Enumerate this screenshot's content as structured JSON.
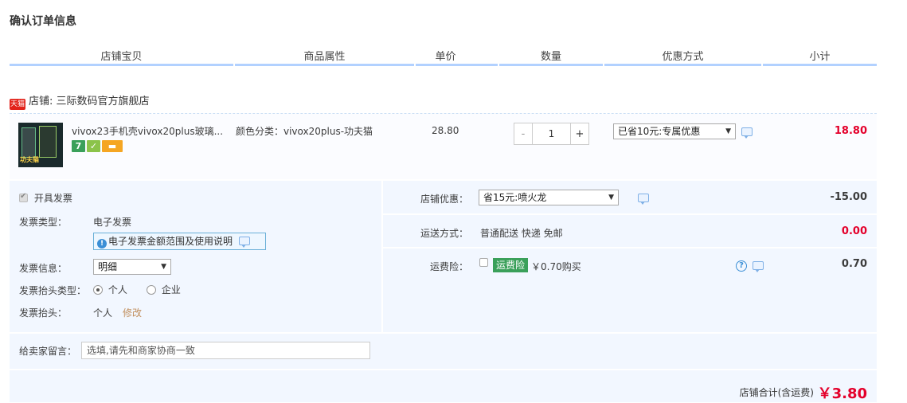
{
  "page_title": "确认订单信息",
  "columns": [
    "店铺宝贝",
    "商品属性",
    "单价",
    "数量",
    "优惠方式",
    "小计"
  ],
  "shop": {
    "logo_text": "天猫",
    "label": "店铺: 三际数码官方旗舰店"
  },
  "item": {
    "title": "vivox23手机壳vivox20plus玻璃...",
    "badges": [
      {
        "name": "seven-day-return-icon",
        "text": "7",
        "color": "#3aa05a"
      },
      {
        "name": "guarantee-icon",
        "text": "✓",
        "color": "#8bc34a"
      },
      {
        "name": "credit-card-icon",
        "text": "▬",
        "color": "#f5a623"
      }
    ],
    "thumb_label": "功夫猫",
    "attribute": "颜色分类：vivox20plus-功夫猫",
    "unit_price": "28.80",
    "qty_minus": "-",
    "quantity": "1",
    "qty_plus": "+",
    "promo_select": "已省10元:专属优惠",
    "subtotal": "18.80"
  },
  "invoice": {
    "enable_label": "开具发票",
    "type_label": "发票类型：",
    "type_value": "电子发票",
    "note": "电子发票金额范围及使用说明",
    "info_label": "发票信息：",
    "info_value": "明细",
    "head_type_label": "发票抬头类型：",
    "head_type_options": [
      "个人",
      "企业"
    ],
    "head_label": "发票抬头：",
    "head_value": "个人",
    "edit_label": "修改"
  },
  "shop_discount": {
    "label": "店铺优惠：",
    "select": "省15元:喷火龙",
    "amount": "-15.00"
  },
  "shipping": {
    "label": "运送方式：",
    "value": "普通配送 快递 免邮",
    "amount": "0.00"
  },
  "insurance": {
    "label": "运费险：",
    "tag": "运费险",
    "price_text": "￥0.70购买",
    "amount": "0.70"
  },
  "message": {
    "label": "给卖家留言：",
    "placeholder": "选填,请先和商家协商一致"
  },
  "total": {
    "label": "店铺合计(含运费)",
    "value": "￥3.80"
  },
  "colors": {
    "accent_red": "#e4002b",
    "panel_bg": "#f2f7ff",
    "header_line": "#b2d1ff"
  }
}
